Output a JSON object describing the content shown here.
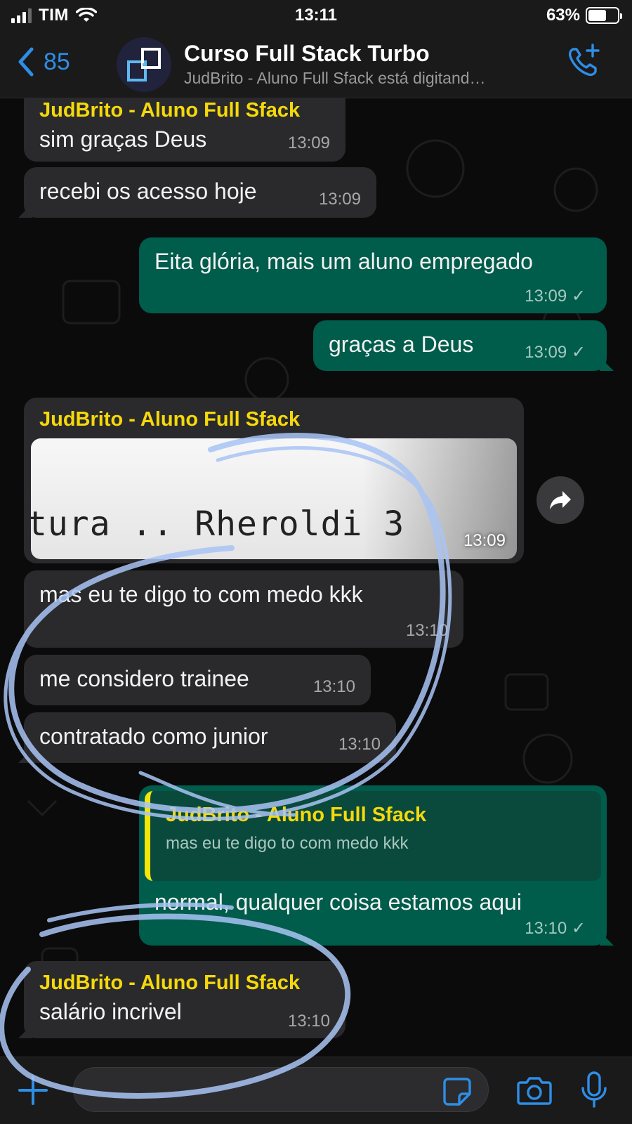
{
  "status_bar": {
    "carrier": "TIM",
    "time": "13:11",
    "battery_percent": "63%",
    "battery_level": 0.63
  },
  "header": {
    "back_count": "85",
    "title": "Curso Full Stack Turbo",
    "subtitle": "JudBrito - Aluno Full Sfack está digitand…"
  },
  "messages": [
    {
      "direction": "in",
      "sender": "JudBrito - Aluno Full Sfack",
      "text": "sim graças Deus",
      "time": "13:09"
    },
    {
      "direction": "in",
      "text": "recebi os acesso hoje",
      "time": "13:09"
    },
    {
      "direction": "out",
      "text": "Eita glória, mais um aluno empregado",
      "time": "13:09",
      "status": "sent"
    },
    {
      "direction": "out",
      "text": "graças a Deus",
      "time": "13:09",
      "status": "sent"
    },
    {
      "direction": "in",
      "sender": "JudBrito - Aluno Full Sfack",
      "image_text": "tura .. Rheroldi 3",
      "time": "13:09"
    },
    {
      "direction": "in",
      "text": "mas eu te digo to com medo kkk",
      "time": "13:10"
    },
    {
      "direction": "in",
      "text": "me considero trainee",
      "time": "13:10"
    },
    {
      "direction": "in",
      "text": "contratado como junior",
      "time": "13:10"
    },
    {
      "direction": "out",
      "quote": {
        "sender": "JudBrito - Aluno Full Sfack",
        "text": "mas eu te digo to com medo kkk"
      },
      "text": "normal, qualquer coisa estamos aqui",
      "time": "13:10",
      "status": "sent"
    },
    {
      "direction": "in",
      "sender": "JudBrito - Aluno Full Sfack",
      "text": "salário incrivel",
      "time": "13:10"
    }
  ],
  "checkmark": "✓",
  "colors": {
    "accent": "#2e8ee6",
    "incoming_bubble": "#2a2a2c",
    "outgoing_bubble": "#005c4b",
    "sender_name": "#f5d90a",
    "scribble": "#a9c4f5"
  },
  "icons": [
    "chevron-left-icon",
    "group-avatar-logo",
    "add-call-icon",
    "forward-icon",
    "plus-icon",
    "sticker-icon",
    "camera-icon",
    "microphone-icon"
  ]
}
